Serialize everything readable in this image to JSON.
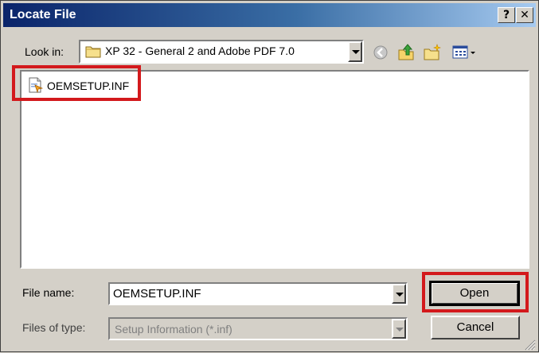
{
  "window": {
    "title": "Locate File",
    "help_glyph": "?",
    "close_glyph": "✕"
  },
  "lookin": {
    "label": "Look in:",
    "value": "XP 32 - General 2 and Adobe PDF 7.0"
  },
  "toolbar": {
    "icons": [
      "back-icon",
      "up-folder-icon",
      "new-folder-icon",
      "view-menu-icon"
    ]
  },
  "files": [
    {
      "name": "OEMSETUP.INF",
      "icon": "setup-file-icon"
    }
  ],
  "filename": {
    "label": "File name:",
    "value": "OEMSETUP.INF"
  },
  "filetype": {
    "label": "Files of type:",
    "value": "Setup Information (*.inf)"
  },
  "buttons": {
    "open": "Open",
    "cancel": "Cancel"
  },
  "colors": {
    "title_start": "#0a246a",
    "title_end": "#a6caf0",
    "highlight": "#d3191c",
    "face": "#d4d0c8"
  }
}
